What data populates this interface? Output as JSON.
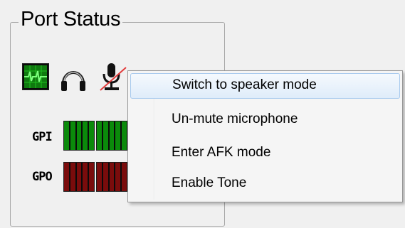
{
  "groupbox": {
    "title": "Port Status"
  },
  "status_icons": [
    {
      "icon": "tone-waveform-icon",
      "state": "active"
    },
    {
      "icon": "headset-icon",
      "state": "normal"
    },
    {
      "icon": "microphone-muted-icon",
      "state": "muted"
    }
  ],
  "gpi": {
    "label": "GPI",
    "color": "#0b8a0b"
  },
  "gpo": {
    "label": "GPO",
    "color": "#7a0c0c"
  },
  "context_menu": {
    "items": [
      {
        "label": "Switch to speaker mode",
        "highlighted": true
      },
      {
        "label": "Un-mute microphone",
        "highlighted": false
      },
      {
        "label": "Enter AFK mode",
        "highlighted": false
      },
      {
        "label": "Enable Tone",
        "highlighted": false
      }
    ]
  },
  "colors": {
    "menu_highlight_border": "#a8caee",
    "mute_slash": "#e23b3b",
    "tone_green": "#18c418"
  }
}
